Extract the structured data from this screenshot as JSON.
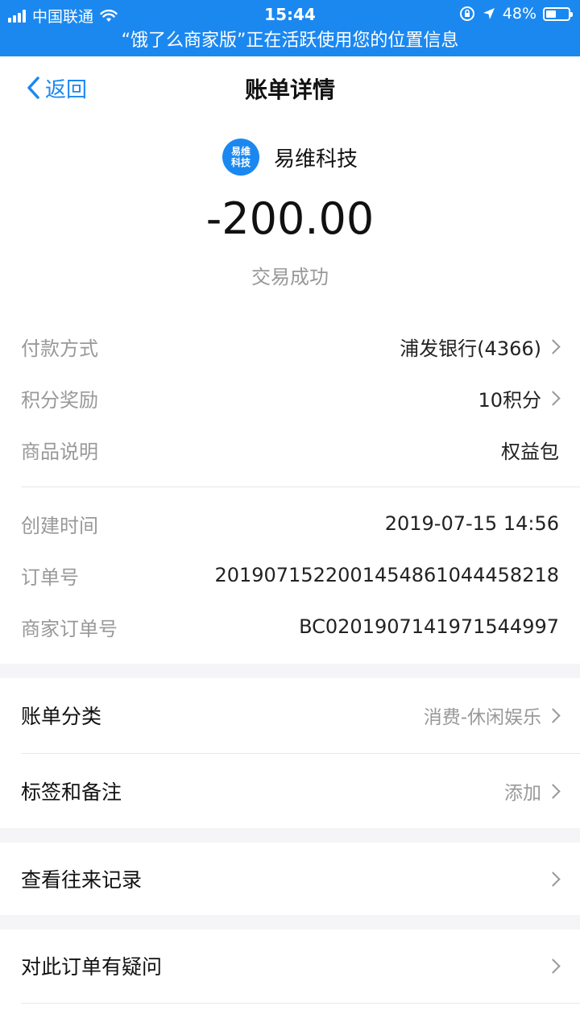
{
  "status_bar": {
    "carrier": "中国联通",
    "time": "15:44",
    "battery": "48%",
    "battery_level": 0.48,
    "banner": "“饿了么商家版”正在活跃使用您的位置信息"
  },
  "nav": {
    "back_label": "返回",
    "title": "账单详情"
  },
  "summary": {
    "logo_line1": "易维",
    "logo_line2": "科技",
    "merchant": "易维科技",
    "amount": "-200.00",
    "status": "交易成功"
  },
  "details": {
    "payment_method": {
      "label": "付款方式",
      "value": "浦发银行(4366)"
    },
    "points": {
      "label": "积分奖励",
      "value": "10积分"
    },
    "product": {
      "label": "商品说明",
      "value": "权益包"
    },
    "created_time": {
      "label": "创建时间",
      "value": "2019-07-15 14:56"
    },
    "order_no": {
      "label": "订单号",
      "value": "2019071522001454861044458218"
    },
    "merchant_order_no": {
      "label": "商家订单号",
      "value": "BC0201907141971544997"
    }
  },
  "actions": {
    "category": {
      "label": "账单分类",
      "value": "消费-休闲娱乐"
    },
    "tags": {
      "label": "标签和备注",
      "value": "添加"
    },
    "history": {
      "label": "查看往来记录"
    },
    "question": {
      "label": "对此订单有疑问"
    }
  },
  "colors": {
    "accent": "#1b88f0",
    "muted": "#999999",
    "background": "#f5f5f7"
  }
}
